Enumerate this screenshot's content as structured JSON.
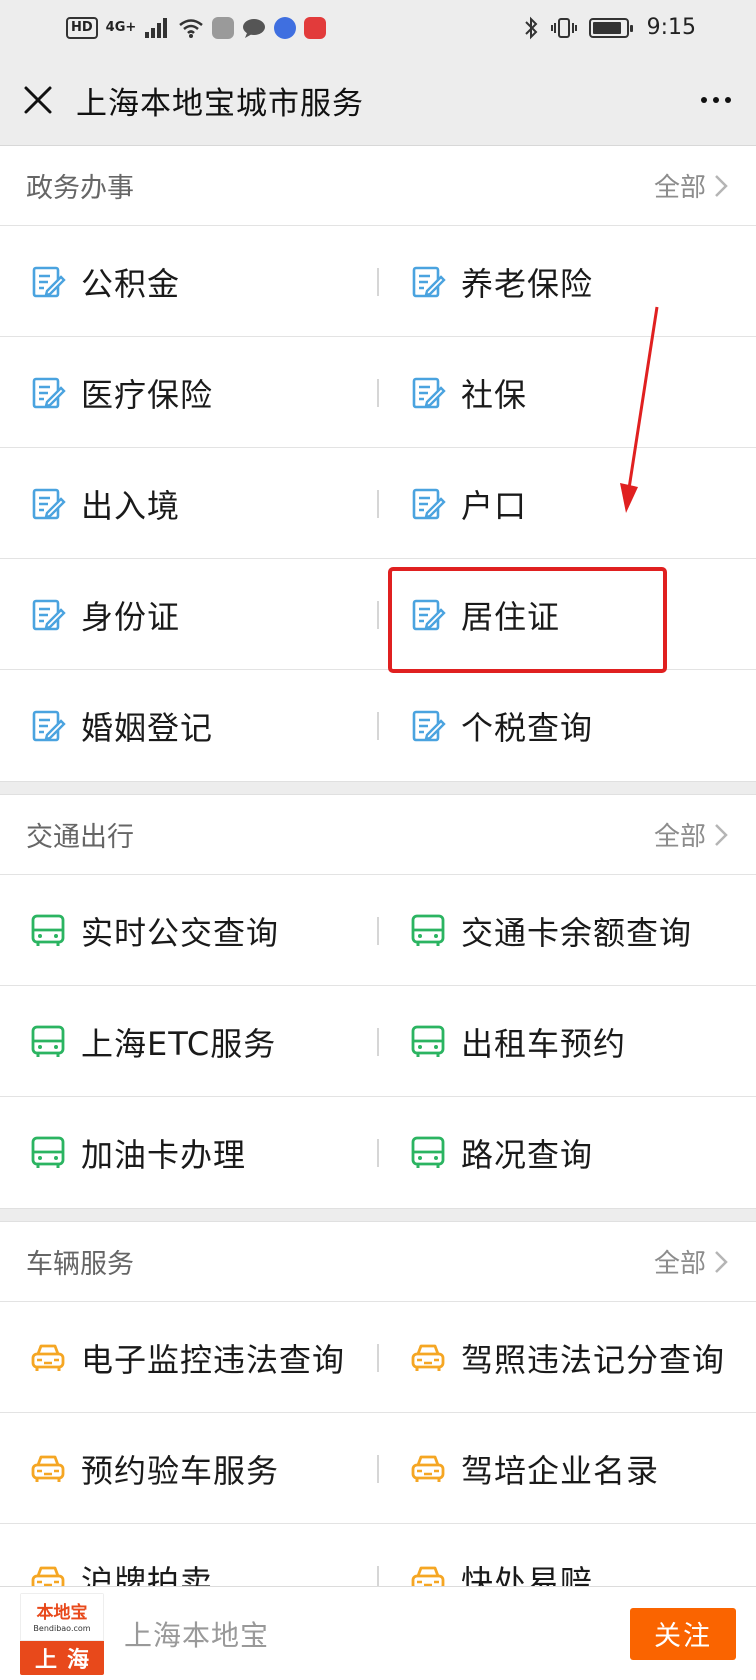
{
  "status_bar": {
    "hd": "HD",
    "network": "4G+",
    "time": "9:15"
  },
  "header": {
    "title": "上海本地宝城市服务"
  },
  "sections": [
    {
      "title": "政务办事",
      "all_label": "全部",
      "icon": "document-edit-icon",
      "icon_color": "#4aa3df",
      "items": [
        "公积金",
        "养老保险",
        "医疗保险",
        "社保",
        "出入境",
        "户口",
        "身份证",
        "居住证",
        "婚姻登记",
        "个税查询"
      ]
    },
    {
      "title": "交通出行",
      "all_label": "全部",
      "icon": "bus-icon",
      "icon_color": "#2bb461",
      "items": [
        "实时公交查询",
        "交通卡余额查询",
        "上海ETC服务",
        "出租车预约",
        "加油卡办理",
        "路况查询"
      ]
    },
    {
      "title": "车辆服务",
      "all_label": "全部",
      "icon": "car-icon",
      "icon_color": "#f5a623",
      "items": [
        "电子监控违法查询",
        "驾照违法记分查询",
        "预约验车服务",
        "驾培企业名录",
        "沪牌拍卖",
        "快处易赔"
      ]
    }
  ],
  "annotation": {
    "highlighted_item": "居住证",
    "color": "#e02020"
  },
  "bottom_bar": {
    "logo_text": "本地宝",
    "logo_domain": "Bendibao.com",
    "logo_city": "上海",
    "account_name": "上海本地宝",
    "follow_label": "关注",
    "follow_color": "#fa6400"
  }
}
